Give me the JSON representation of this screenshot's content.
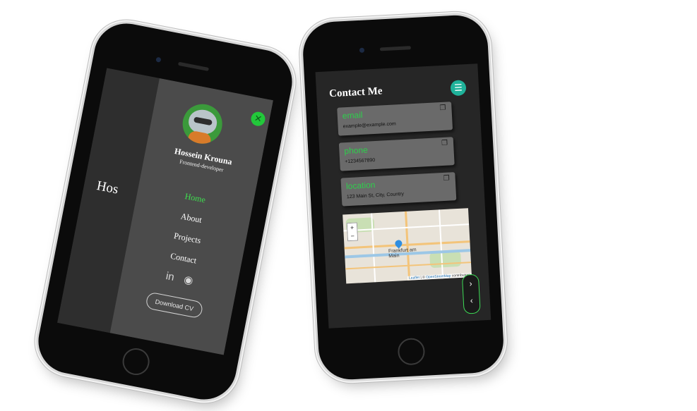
{
  "phone1": {
    "hero_text": "Hos",
    "drawer": {
      "name": "Hossein Krouna",
      "role": "Frontend-developer",
      "close_icon": "close-icon",
      "nav": [
        {
          "label": "Home",
          "active": true
        },
        {
          "label": "About",
          "active": false
        },
        {
          "label": "Projects",
          "active": false
        },
        {
          "label": "Contact",
          "active": false
        }
      ],
      "social": {
        "linkedin": "in",
        "github": "◉"
      },
      "cv_button": "Download CV"
    }
  },
  "phone2": {
    "title": "Contact Me",
    "menu_icon": "☰",
    "cards": [
      {
        "label": "email",
        "value": "example@example.com"
      },
      {
        "label": "phone",
        "value": "+1234567890"
      },
      {
        "label": "location",
        "value": "123 Main St, City, Country"
      }
    ],
    "map": {
      "zoom_in": "+",
      "zoom_out": "−",
      "city": "Frankfurt am Main",
      "attribution_leaflet": "Leaflet",
      "attribution_sep": " | © ",
      "attribution_osm": "OpenStreetMap",
      "attribution_tail": " contributors"
    },
    "pager": {
      "next": "›",
      "prev": "‹"
    }
  },
  "colors": {
    "accent_green": "#2ecf4c",
    "menu_teal": "#1fb29a"
  }
}
